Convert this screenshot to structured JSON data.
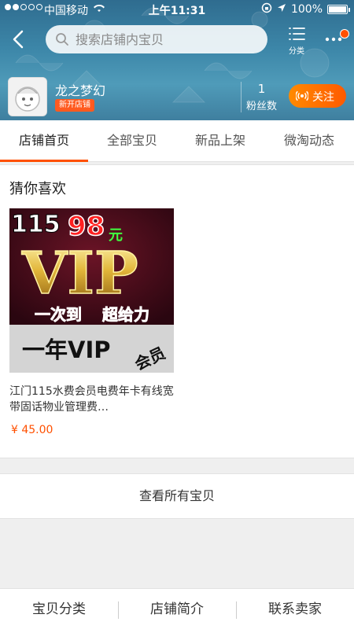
{
  "status_bar": {
    "carrier": "中国移动",
    "time": "上午11:31",
    "battery": "100%"
  },
  "header": {
    "search_placeholder": "搜索店铺内宝贝",
    "category_label": "分类",
    "shop_name": "龙之梦幻",
    "shop_badge": "新开店铺",
    "fans_count": "1",
    "fans_label": "粉丝数",
    "follow_label": "关注"
  },
  "tabs": [
    {
      "label": "店铺首页",
      "active": true
    },
    {
      "label": "全部宝贝",
      "active": false
    },
    {
      "label": "新品上架",
      "active": false
    },
    {
      "label": "微淘动态",
      "active": false
    }
  ],
  "guess_section": {
    "title": "猜你喜欢",
    "products": [
      {
        "title": "江门115水费会员电费年卡有线宽带固话物业管理费…",
        "price": "¥ 45.00",
        "image_text": {
          "top_left": "115",
          "price_big": "98",
          "price_unit": "元",
          "vip": "VIP",
          "slogan_left": "一次到",
          "slogan_right": "超给力",
          "bottom": "一年VIP",
          "member": "会员"
        }
      }
    ]
  },
  "view_all_label": "查看所有宝贝",
  "bottom_bar": [
    {
      "label": "宝贝分类"
    },
    {
      "label": "店铺简介"
    },
    {
      "label": "联系卖家"
    }
  ],
  "colors": {
    "accent": "#ff5000",
    "header_blue": "#3c86a8",
    "follow_orange": "#ff7a00"
  }
}
